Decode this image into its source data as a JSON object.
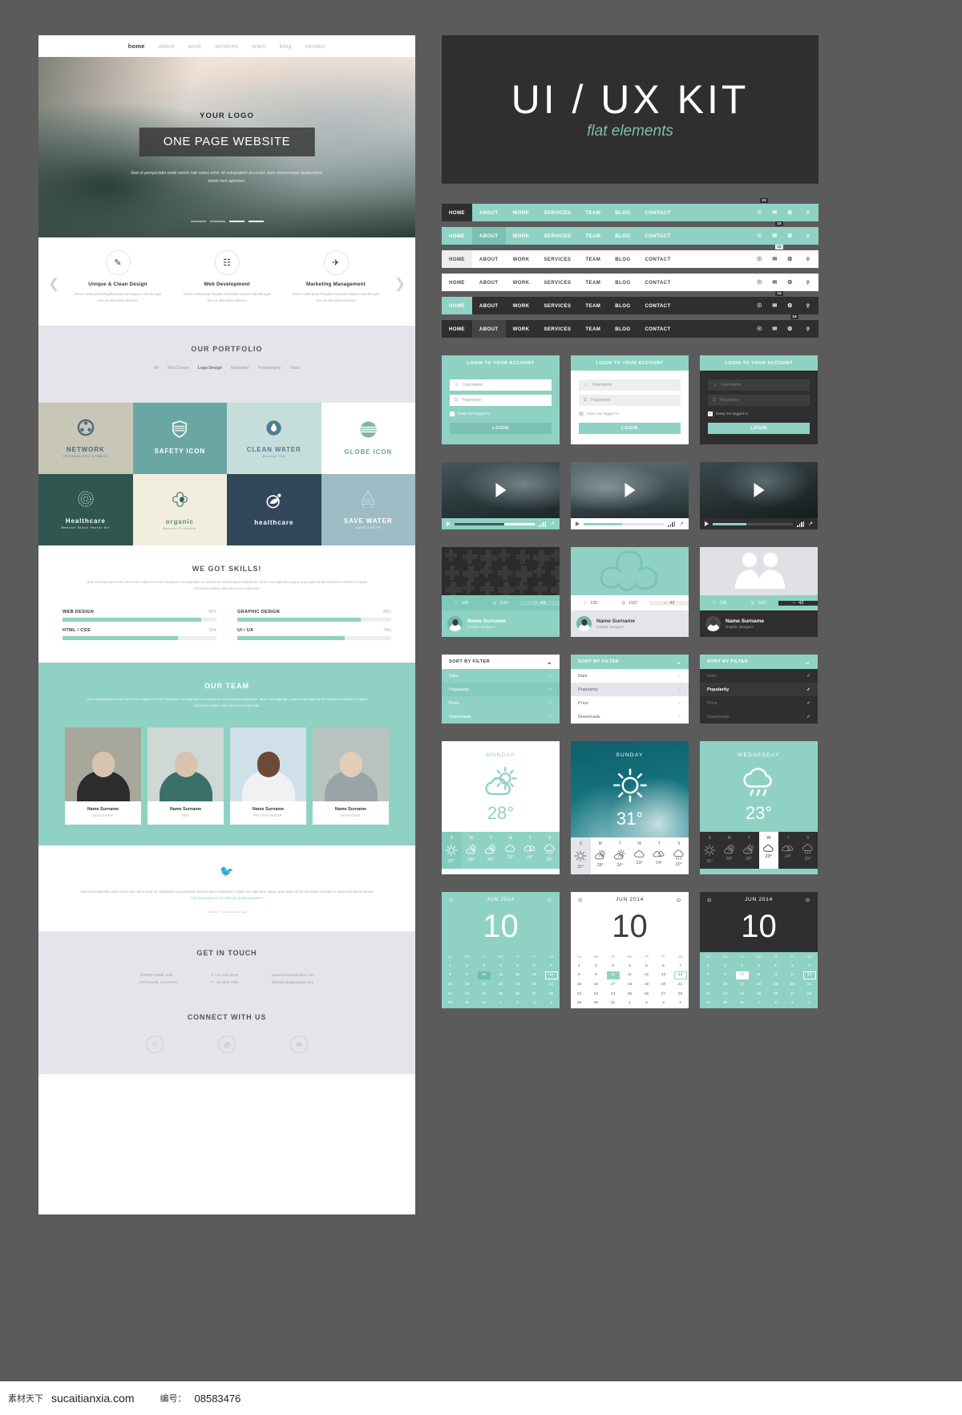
{
  "banner": {
    "title": "UI / UX KIT",
    "subtitle": "flat elements"
  },
  "colors": {
    "accent": "#8fd2c4",
    "dark": "#2f2f2f",
    "light_grey": "#e3e5ea",
    "white": "#ffffff"
  },
  "website": {
    "nav": [
      {
        "label": "home",
        "active": true
      },
      {
        "label": "about",
        "active": false
      },
      {
        "label": "work",
        "active": false
      },
      {
        "label": "services",
        "active": false
      },
      {
        "label": "team",
        "active": false
      },
      {
        "label": "blog",
        "active": false
      },
      {
        "label": "contact",
        "active": false
      }
    ],
    "hero": {
      "logo": "YOUR LOGO",
      "cta": "ONE PAGE WEBSITE",
      "paragraph": "Sed ut perspiciatis unde omnis iste natus error sit voluptatem accusan-  tium doloremque laudantium, totam rem aperiam.",
      "slides": 4,
      "active_slide": 2
    },
    "services": {
      "prev_icon": "chevron-left-icon",
      "next_icon": "chevron-right-icon",
      "items": [
        {
          "icon": "pen-nib-icon",
          "title": "Unique & Clean Design",
          "text": "Donec unde justo fringilla accumsan neque a iaculis eget arcu in ante justo rhoncus"
        },
        {
          "icon": "globe-web-icon",
          "title": "Web Development",
          "text": "Donec unde justo fringilla accumsan neque a iaculis eget arcu in ante justo rhoncus"
        },
        {
          "icon": "rocket-icon",
          "title": "Marketing Management",
          "text": "Donec unde justo fringilla accumsan neque a iaculis eget arcu in ante justo rhoncus"
        }
      ]
    },
    "portfolio": {
      "title": "OUR PORTFOLIO",
      "filters": [
        {
          "label": "All",
          "active": false
        },
        {
          "label": "Web Design",
          "active": false
        },
        {
          "label": "Logo Design",
          "active": true
        },
        {
          "label": "Illustration",
          "active": false
        },
        {
          "label": "Photography",
          "active": false
        },
        {
          "label": "Video",
          "active": false
        }
      ],
      "tiles": [
        {
          "title": "NETWORK",
          "sub": "TECHNOLOGY SYMBOL",
          "bg": "#c8c6b6",
          "fg": "#4d6a80",
          "icon": "network-sphere-icon"
        },
        {
          "title": "SAFETY ICON",
          "sub": "",
          "bg": "#6aa7a3",
          "fg": "#ffffff",
          "icon": "shield-icon"
        },
        {
          "title": "CLEAN WATER",
          "sub": "healthy life",
          "bg": "#c5dedb",
          "fg": "#4d7d92",
          "icon": "water-drop-icon"
        },
        {
          "title": "GLOBE ICON",
          "sub": "",
          "bg": "#ffffff",
          "fg": "#6aa898",
          "icon": "globe-stripes-icon"
        },
        {
          "title": "Healthcare",
          "sub": "Medical Stock Vector Art",
          "bg": "#2f564f",
          "fg": "#ffffff",
          "icon": "dotted-sphere-icon"
        },
        {
          "title": "organic",
          "sub": "Natural Products",
          "bg": "#f2eede",
          "fg": "#5d8d85",
          "icon": "flower-leaf-icon"
        },
        {
          "title": "healthcare",
          "sub": "",
          "bg": "#32475a",
          "fg": "#ffffff",
          "icon": "leaf-circle-icon"
        },
        {
          "title": "SAVE WATER",
          "sub": "SAVE EARTH",
          "bg": "#9dbcc6",
          "fg": "#ffffff",
          "icon": "dotted-drop-icon"
        }
      ]
    },
    "skills": {
      "title": "WE GOT SKILLS!",
      "lead": "Sed ut perspiciatis unde omnis iste natus error sit voluptatem accusantium accusantium doloremque laudantium, totam rem aperiam, eaque ipsa quae ab illo inventore veritatis et quasi architecto beatae vitae dicta sunt explicabo.",
      "bars": [
        {
          "name": "WEB DESIGN",
          "value": "90%",
          "pct": 90
        },
        {
          "name": "GRAPHIC DESIGN",
          "value": "80%",
          "pct": 80
        },
        {
          "name": "HTML / CSS",
          "value": "75%",
          "pct": 75
        },
        {
          "name": "UI / UX",
          "value": "70%",
          "pct": 70
        }
      ]
    },
    "team": {
      "title": "OUR TEAM",
      "lead": "Sed ut perspiciatis unde omnis iste natus error sit voluptatem accusantium accusantium doloremque laudantium, totam rem aperiam, eaque ipsa quae ab illo inventore veritatis et quasi architecto beatae vitae dicta sunt explicabo.",
      "members": [
        {
          "name": "Name Surname",
          "role": "DESIGNER",
          "bg": "#a8a79b",
          "skin": "#d8c4ae"
        },
        {
          "name": "Name Surname",
          "role": "SEO",
          "bg": "#cfd8d4",
          "skin": "#d8c4ae"
        },
        {
          "name": "Name Surname",
          "role": "PROGRAMMER",
          "bg": "#cfe0ea",
          "skin": "#6b4a36"
        },
        {
          "name": "Name Surname",
          "role": "MANAGER",
          "bg": "#b9c3c0",
          "skin": "#e2cdb6"
        }
      ]
    },
    "tweet": {
      "icon": "twitter-bird-icon",
      "text": "Sed ut perspiciatis unde omnis iste natus error sit voluptatem accusantium doloremque laudantium, totam rem aperiam, eaque ipsa quae ab illo inventore veritatis et quasi architecto beatae ",
      "link": "http://www.ipsum.com/laboret-quia/voluptatem",
      "meta": "@name 7 days 48 mins ago"
    },
    "contact": {
      "title": "GET IN TOUCH",
      "col1": "STREET NAME 1234\nCITY NAME, COUNTRY",
      "col2": "T: +10 1234 5678\nF: +10 2345 6789",
      "col3": "name-surname@office.com\noffice@companyname.com",
      "connect_title": "CONNECT WITH US",
      "socials": [
        "skype-icon",
        "at-sign-icon",
        "envelope-icon"
      ]
    }
  },
  "navbars": {
    "items": [
      "HOME",
      "ABOUT",
      "WORK",
      "SERVICES",
      "TEAM",
      "BLOG",
      "CONTACT"
    ],
    "icons": [
      "skype-icon",
      "envelope-icon",
      "gear-icon"
    ],
    "search_icon": "search-icon",
    "bars": [
      {
        "variant": "tealbar",
        "active_index": 0,
        "badge": "15",
        "badge_on": 0
      },
      {
        "variant": "tealbar2",
        "active_index": 1,
        "badge": "15",
        "badge_on": 1
      },
      {
        "variant": "whitebar",
        "active_index": 0,
        "badge": "15",
        "badge_on": 1
      },
      {
        "variant": "whitebar",
        "active_index": null,
        "badge": "",
        "badge_on": null
      },
      {
        "variant": "darkbar",
        "active_index": 0,
        "badge": "15",
        "badge_on": 1
      },
      {
        "variant": "darkbar2",
        "active_index": 1,
        "badge": "15",
        "badge_on": 2
      }
    ]
  },
  "login": {
    "title": "LOGIN TO YOUR ACCOUNT",
    "username_placeholder": "Username",
    "password_placeholder": "Password",
    "keep_logged_in": "Keep me logged in",
    "button": "LOGIN",
    "user_icon": "user-icon",
    "lock_icon": "lock-icon",
    "check_icon": "check-icon"
  },
  "video": {
    "play_icon": "play-triangle-icon",
    "equalizer_icon": "equalizer-icon",
    "fullscreen_icon": "fullscreen-icon",
    "progress": [
      62,
      48,
      42
    ]
  },
  "social_card": {
    "likes": "130",
    "views": "1157",
    "comments": "43",
    "like_icon": "heart-icon",
    "view_icon": "eye-icon",
    "comment_icon": "speech-bubble-icon",
    "name": "Name Surname",
    "role": "Graphic Designer",
    "avatar": "avatar-icon"
  },
  "sort_filter": {
    "header": "SORT BY FILTER",
    "chevron_icon": "chevron-down-icon",
    "check_icon": "check-icon",
    "options": [
      "Date",
      "Popularity",
      "Price",
      "Downloads"
    ],
    "selected_index": 1
  },
  "weather": [
    {
      "day": "MONDAY",
      "temp": "28°",
      "icon": "sun-behind-cloud-icon",
      "forecast": [
        {
          "d": "S",
          "t": "31°",
          "i": "sun-icon"
        },
        {
          "d": "M",
          "t": "28°",
          "i": "sun-behind-cloud-icon"
        },
        {
          "d": "T",
          "t": "26°",
          "i": "sun-behind-cloud-icon"
        },
        {
          "d": "W",
          "t": "23°",
          "i": "cloud-icon"
        },
        {
          "d": "T",
          "t": "24°",
          "i": "clouds-icon"
        },
        {
          "d": "S",
          "t": "20°",
          "i": "rain-cloud-icon"
        }
      ]
    },
    {
      "day": "SUNDAY",
      "temp": "31°",
      "icon": "sun-icon",
      "forecast": [
        {
          "d": "S",
          "t": "31°",
          "i": "sun-icon"
        },
        {
          "d": "M",
          "t": "28°",
          "i": "sun-behind-cloud-icon"
        },
        {
          "d": "T",
          "t": "26°",
          "i": "sun-behind-cloud-icon"
        },
        {
          "d": "W",
          "t": "23°",
          "i": "cloud-icon"
        },
        {
          "d": "T",
          "t": "24°",
          "i": "clouds-icon"
        },
        {
          "d": "S",
          "t": "20°",
          "i": "rain-cloud-icon"
        }
      ]
    },
    {
      "day": "WEDNESDAY",
      "temp": "23°",
      "icon": "rain-cloud-icon",
      "forecast": [
        {
          "d": "S",
          "t": "31°",
          "i": "sun-icon"
        },
        {
          "d": "M",
          "t": "28°",
          "i": "sun-behind-cloud-icon"
        },
        {
          "d": "T",
          "t": "26°",
          "i": "sun-behind-cloud-icon"
        },
        {
          "d": "W",
          "t": "23°",
          "i": "cloud-icon"
        },
        {
          "d": "T",
          "t": "24°",
          "i": "clouds-icon"
        },
        {
          "d": "S",
          "t": "20°",
          "i": "rain-cloud-icon"
        }
      ]
    }
  ],
  "calendar": {
    "month": "JUN 2014",
    "big_day": "10",
    "prev_icon": "circle-dot-icon",
    "next_icon": "circle-dot-icon",
    "weekdays": [
      "Su",
      "Mo",
      "Tu",
      "We",
      "Th",
      "Fr",
      "Sa"
    ],
    "days": [
      1,
      2,
      3,
      4,
      5,
      6,
      7,
      8,
      9,
      10,
      11,
      12,
      13,
      14,
      15,
      16,
      17,
      18,
      19,
      20,
      21,
      22,
      23,
      24,
      25,
      26,
      27,
      28,
      29,
      30,
      31,
      1,
      2,
      3,
      4
    ],
    "highlighted": 10,
    "outlined": 14
  },
  "watermark": {
    "chinese": "素材天下",
    "site": "sucaitianxia.com",
    "label": "编号：",
    "number": "08583476"
  }
}
